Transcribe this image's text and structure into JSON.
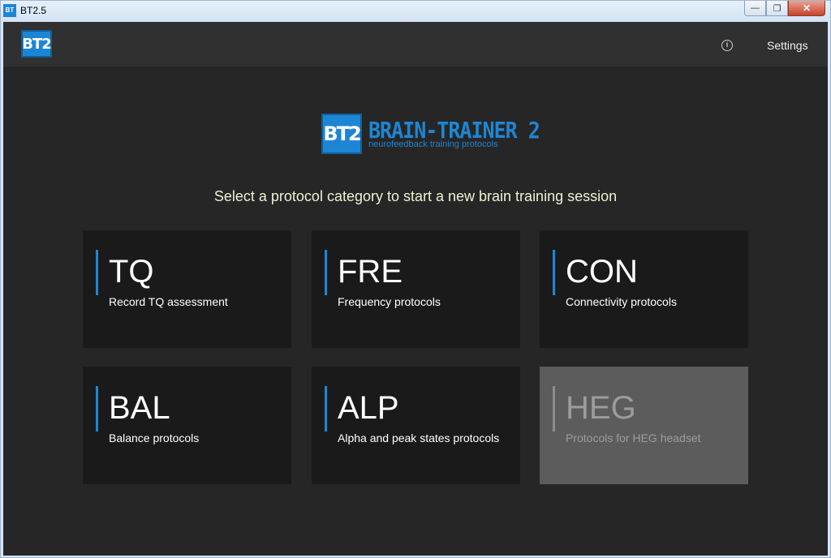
{
  "window": {
    "title": "BT2.5",
    "icon_text": "BT"
  },
  "header": {
    "logo_text": "BT2",
    "settings_label": "Settings",
    "info_icon": "i"
  },
  "brand": {
    "logo_text": "BT2",
    "name": "BRAIN-TRAINER 2",
    "tagline": "neurofeedback training protocols"
  },
  "prompt": "Select a protocol category to start a new brain training session",
  "cards": [
    {
      "code": "TQ",
      "desc": "Record TQ assessment",
      "enabled": true
    },
    {
      "code": "FRE",
      "desc": "Frequency protocols",
      "enabled": true
    },
    {
      "code": "CON",
      "desc": "Connectivity protocols",
      "enabled": true
    },
    {
      "code": "BAL",
      "desc": "Balance protocols",
      "enabled": true
    },
    {
      "code": "ALP",
      "desc": "Alpha and peak states protocols",
      "enabled": true
    },
    {
      "code": "HEG",
      "desc": "Protocols for HEG headset",
      "enabled": false
    }
  ],
  "colors": {
    "accent": "#1d86d4",
    "background": "#262626",
    "card": "#1a1a1a",
    "card_disabled": "#5c5c5c"
  }
}
